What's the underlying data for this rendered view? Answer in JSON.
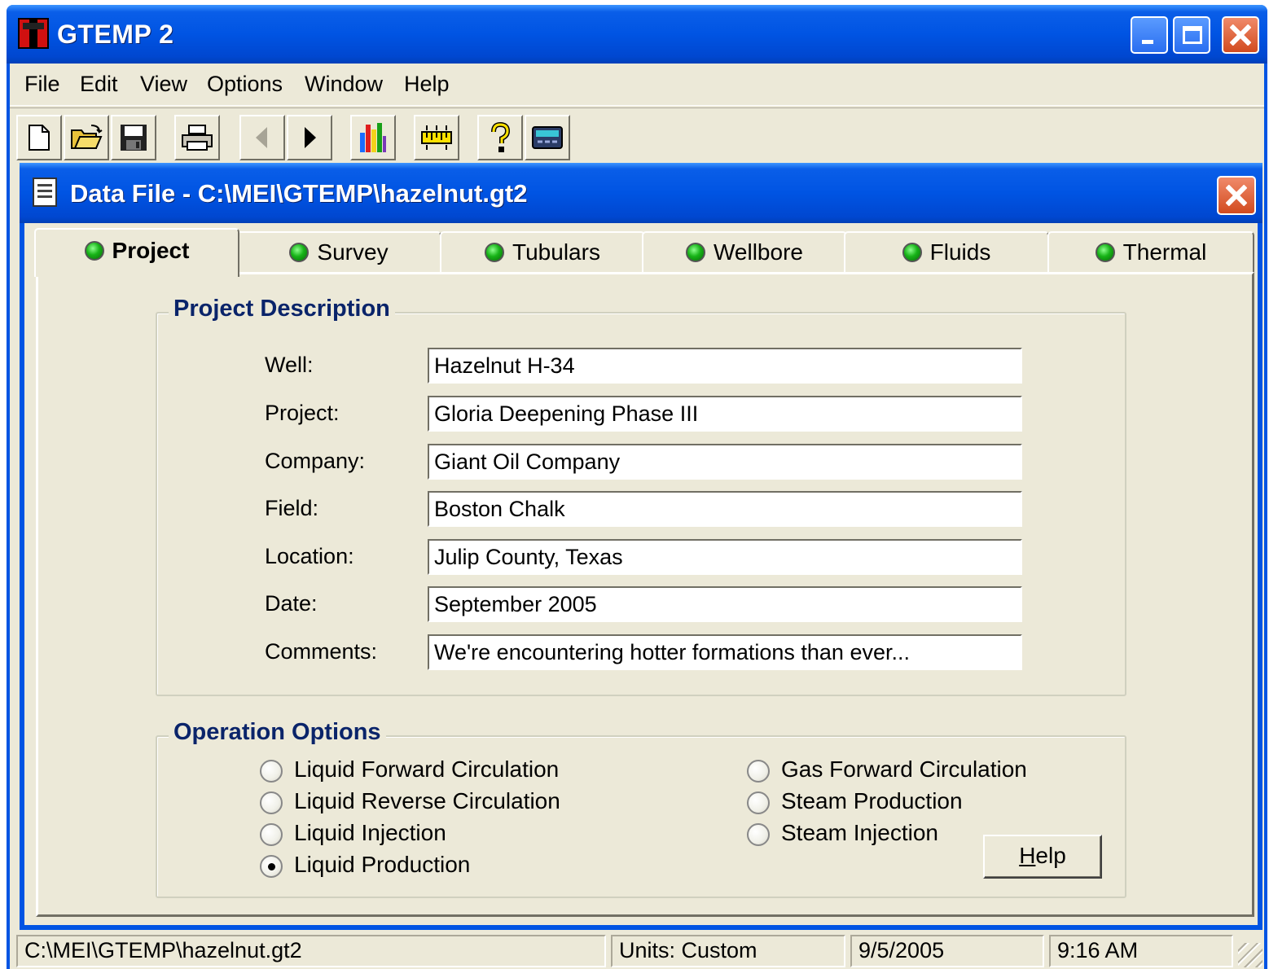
{
  "app": {
    "title": "GTEMP 2"
  },
  "menubar": {
    "items": [
      "File",
      "Edit",
      "View",
      "Options",
      "Window",
      "Help"
    ]
  },
  "toolbar": {
    "buttons": [
      "new-icon",
      "open-icon",
      "save-icon",
      "print-icon",
      "back-arrow-icon",
      "forward-arrow-icon",
      "chart-icon",
      "ruler-icon",
      "help-icon",
      "calculator-icon"
    ]
  },
  "child_window": {
    "title": "Data File - C:\\MEI\\GTEMP\\hazelnut.gt2"
  },
  "tabs": [
    {
      "label": "Project",
      "active": true
    },
    {
      "label": "Survey",
      "active": false
    },
    {
      "label": "Tubulars",
      "active": false
    },
    {
      "label": "Wellbore",
      "active": false
    },
    {
      "label": "Fluids",
      "active": false
    },
    {
      "label": "Thermal",
      "active": false
    }
  ],
  "project_description": {
    "legend": "Project Description",
    "fields": [
      {
        "label": "Well:",
        "value": "Hazelnut H-34"
      },
      {
        "label": "Project:",
        "value": "Gloria Deepening Phase III"
      },
      {
        "label": "Company:",
        "value": "Giant Oil Company"
      },
      {
        "label": "Field:",
        "value": "Boston Chalk"
      },
      {
        "label": "Location:",
        "value": "Julip County, Texas"
      },
      {
        "label": "Date:",
        "value": "September 2005"
      },
      {
        "label": "Comments:",
        "value": "We're encountering hotter formations than ever..."
      }
    ]
  },
  "operation_options": {
    "legend": "Operation Options",
    "left": [
      {
        "label": "Liquid Forward Circulation",
        "checked": false
      },
      {
        "label": "Liquid Reverse Circulation",
        "checked": false
      },
      {
        "label": "Liquid Injection",
        "checked": false
      },
      {
        "label": "Liquid Production",
        "checked": true
      }
    ],
    "right": [
      {
        "label": "Gas Forward Circulation",
        "checked": false
      },
      {
        "label": "Steam Production",
        "checked": false
      },
      {
        "label": "Steam Injection",
        "checked": false
      }
    ],
    "help_button": {
      "mnemonic": "H",
      "rest": "elp"
    }
  },
  "statusbar": {
    "path": "C:\\MEI\\GTEMP\\hazelnut.gt2",
    "units": "Units: Custom",
    "date": "9/5/2005",
    "time": "9:16 AM"
  },
  "colors": {
    "titlebar_blue": "#0054e3",
    "window_face": "#ece9d8",
    "group_legend": "#0a246a",
    "tab_led_green": "#17b317"
  }
}
